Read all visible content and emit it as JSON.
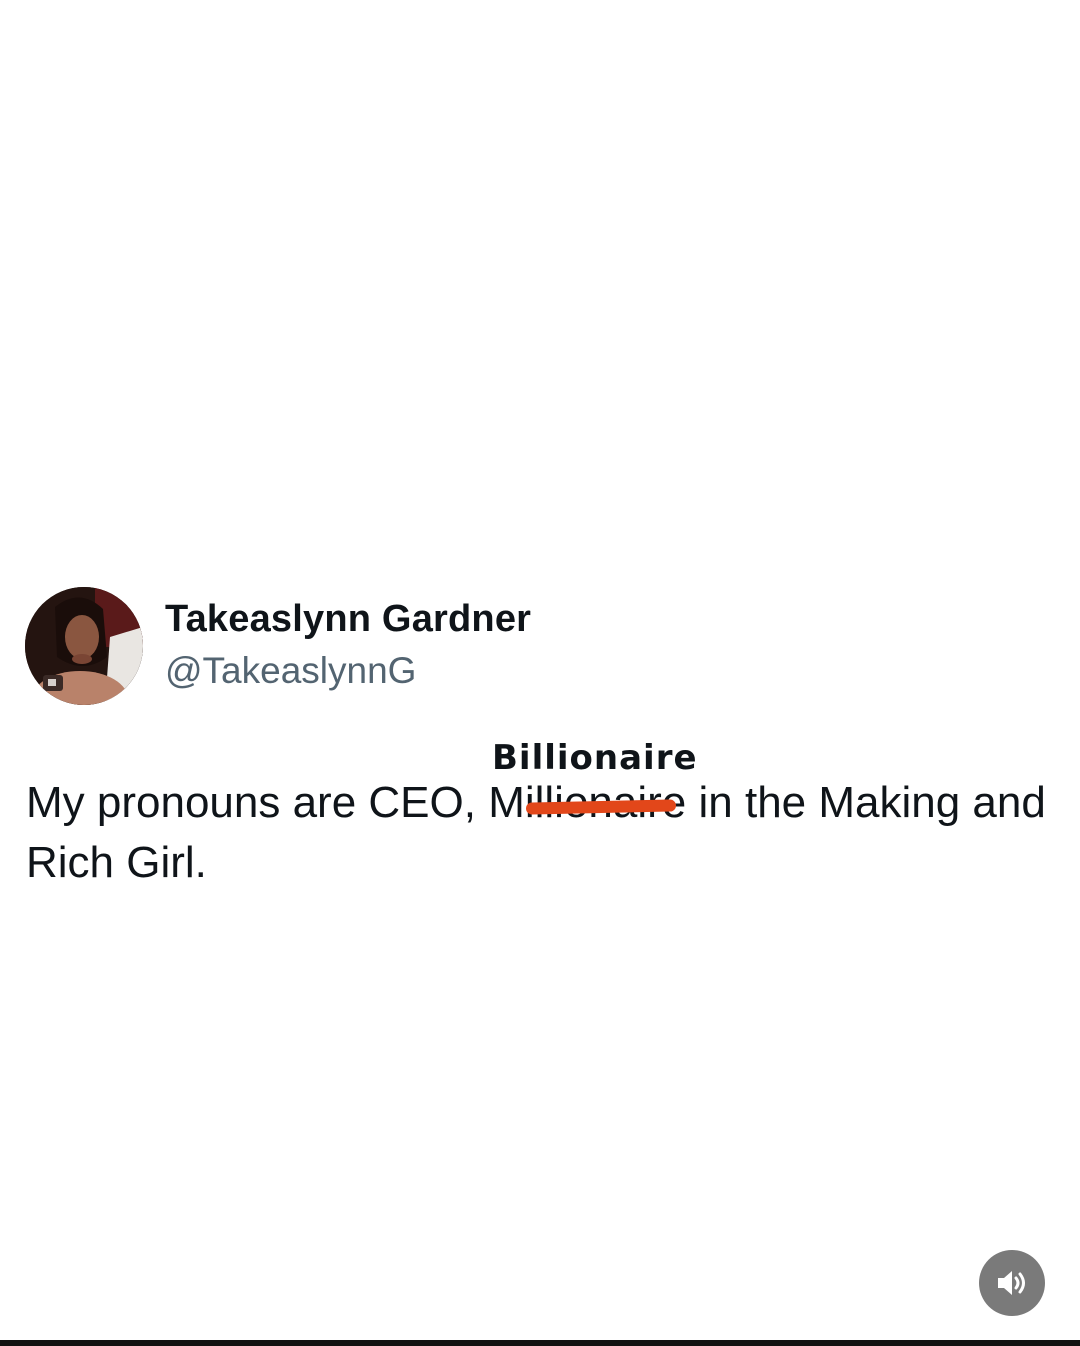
{
  "tweet": {
    "display_name": "Takeaslynn Gardner",
    "handle": "@TakeaslynnG",
    "text_before": "My pronouns are CEO, ",
    "struck_word": "Millionaire",
    "text_after": " in the Making and Rich Girl.",
    "overwrite_word": "Billionaire"
  },
  "icons": {
    "avatar": "profile-photo",
    "sound": "speaker-volume-icon"
  },
  "colors": {
    "text": "#0f1419",
    "handle": "#536471",
    "strike": "#e2471a",
    "sound_button": "#7a7a7a"
  }
}
